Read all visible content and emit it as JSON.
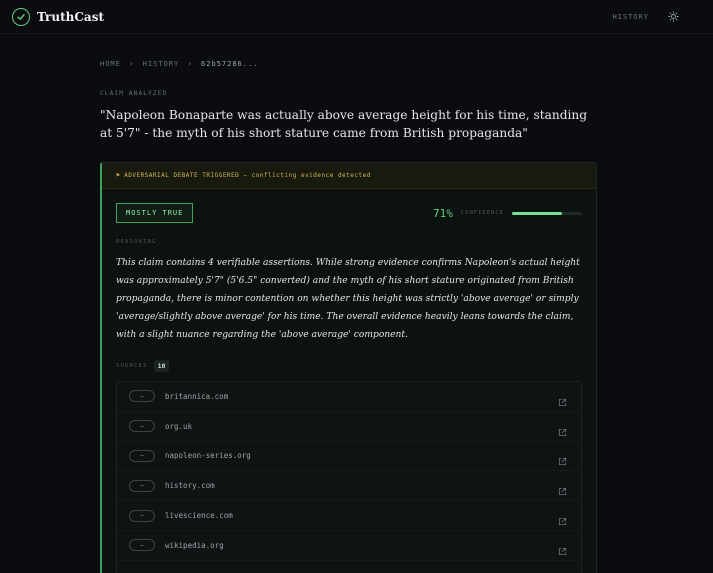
{
  "app": {
    "name": "TruthCast",
    "nav_history": "HISTORY"
  },
  "breadcrumb": {
    "home": "HOME",
    "history": "HISTORY",
    "current": "62b57286..."
  },
  "claim": {
    "label": "CLAIM ANALYZED",
    "text": "\"Napoleon Bonaparte was actually above average height for his time, standing at 5'7\" - the myth of his short stature came from British propaganda\""
  },
  "result": {
    "banner": "ADVERSARIAL DEBATE TRIGGERED — conflicting evidence detected",
    "verdict": "MOSTLY TRUE",
    "confidence_text": "71%",
    "confidence_value": 0.71,
    "confidence_label": "CONFIDENCE",
    "reasoning_label": "REASONING",
    "reasoning": "This claim contains 4 verifiable assertions. While strong evidence confirms Napoleon's actual height was approximately 5'7\" (5'6.5\" converted) and the myth of his short stature originated from British propaganda, there is minor contention on whether this height was strictly 'above average' or simply 'average/slightly above average' for his time. The overall evidence heavily leans towards the claim, with a slight nuance regarding the 'above average' component.",
    "sources_label": "SOURCES",
    "sources_count": "10",
    "sources": [
      {
        "stance": "–",
        "domain": "britannica.com"
      },
      {
        "stance": "–",
        "domain": "org.uk"
      },
      {
        "stance": "–",
        "domain": "napoleon-series.org"
      },
      {
        "stance": "–",
        "domain": "history.com"
      },
      {
        "stance": "–",
        "domain": "livescience.com"
      },
      {
        "stance": "–",
        "domain": "wikipedia.org"
      }
    ]
  },
  "colors": {
    "accent": "#5ccf7c",
    "warning": "#d4b44c",
    "background": "#0b0c0f"
  }
}
